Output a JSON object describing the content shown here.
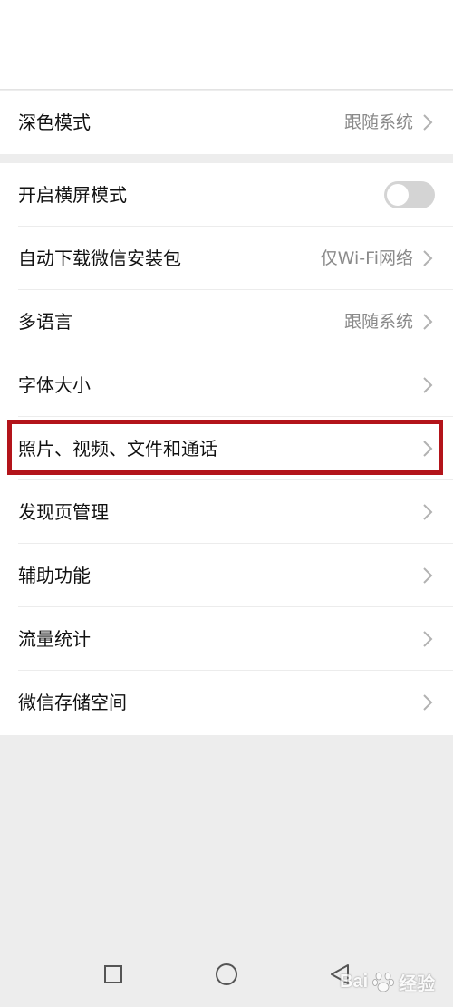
{
  "settings": {
    "dark_mode": {
      "label": "深色模式",
      "value": "跟随系统"
    },
    "landscape": {
      "label": "开启横屏模式",
      "enabled": false
    },
    "auto_download": {
      "label": "自动下载微信安装包",
      "value": "仅Wi-Fi网络"
    },
    "language": {
      "label": "多语言",
      "value": "跟随系统"
    },
    "font_size": {
      "label": "字体大小"
    },
    "media": {
      "label": "照片、视频、文件和通话"
    },
    "discover": {
      "label": "发现页管理"
    },
    "accessibility": {
      "label": "辅助功能"
    },
    "traffic": {
      "label": "流量统计"
    },
    "storage": {
      "label": "微信存储空间"
    }
  },
  "highlight_color": "#b3141a",
  "watermark": {
    "brand_left": "Bai",
    "brand_right": "经验"
  }
}
